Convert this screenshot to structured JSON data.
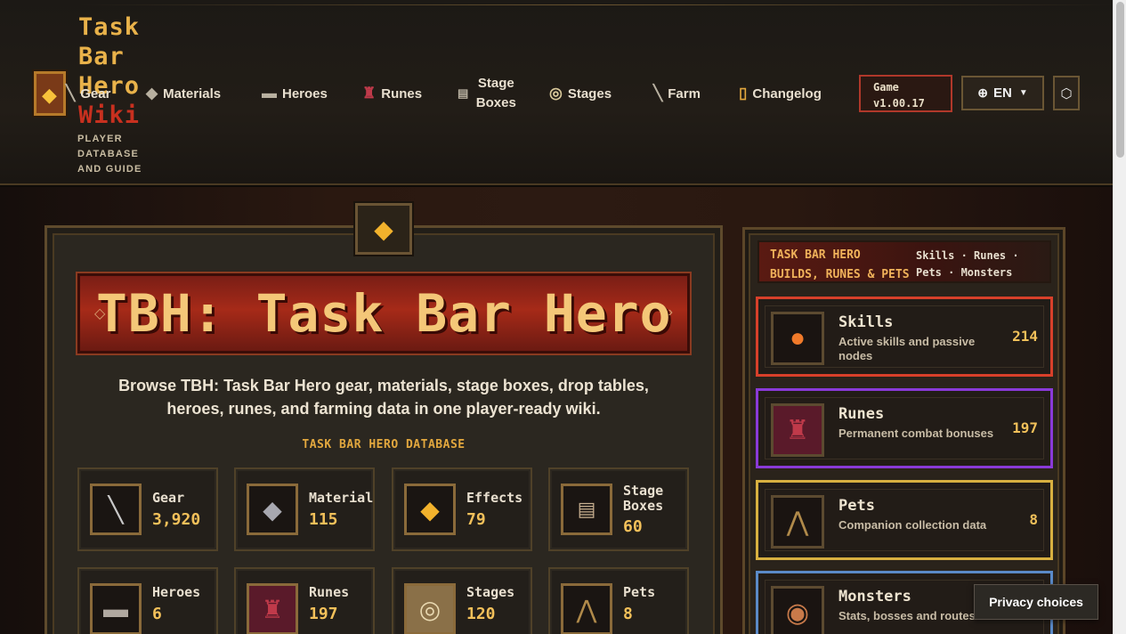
{
  "header": {
    "logo_line1": "Task",
    "logo_line2": "Bar",
    "logo_line3": "Hero",
    "logo_line4": "Wiki",
    "logo_sub": "PLAYER DATABASE AND GUIDE",
    "nav": [
      {
        "label": "Gear",
        "icon": "sword-icon"
      },
      {
        "label": "Materials",
        "icon": "ore-icon"
      },
      {
        "label": "Heroes",
        "icon": "hero-icon"
      },
      {
        "label": "Runes",
        "icon": "rune-icon"
      },
      {
        "label": "Stage Boxes",
        "icon": "chest-icon"
      },
      {
        "label": "Stages",
        "icon": "portal-icon"
      },
      {
        "label": "Farm",
        "icon": "sword-icon"
      },
      {
        "label": "Changelog",
        "icon": "scroll-icon"
      }
    ],
    "game_label": "Game",
    "game_version": "v1.00.17",
    "language": "EN"
  },
  "main": {
    "banner_title": "TBH: Task Bar Hero Wiki",
    "intro": "Browse TBH: Task Bar Hero gear, materials, stage boxes, drop tables, heroes, runes, and farming data in one player-ready wiki.",
    "db_label": "TASK BAR HERO DATABASE",
    "cards": [
      {
        "name": "Gear",
        "count": "3,920",
        "icon": "sword-icon"
      },
      {
        "name": "Material",
        "count": "115",
        "icon": "ore-icon"
      },
      {
        "name": "Effects",
        "count": "79",
        "icon": "gem-icon"
      },
      {
        "name": "Stage Boxes",
        "count": "60",
        "icon": "chest-icon"
      },
      {
        "name": "Heroes",
        "count": "6",
        "icon": "hero-icon"
      },
      {
        "name": "Runes",
        "count": "197",
        "icon": "rune-icon"
      },
      {
        "name": "Stages",
        "count": "120",
        "icon": "portal-icon"
      },
      {
        "name": "Pets",
        "count": "8",
        "icon": "bat-icon"
      }
    ]
  },
  "sidebar": {
    "title_line1": "TASK BAR HERO",
    "title_line2": "BUILDS, RUNES & PETS",
    "links_line1": "Skills · Runes ·",
    "links_line2": "Pets · Monsters",
    "categories": [
      {
        "name": "Skills",
        "desc": "Active skills and passive nodes",
        "count": "214",
        "color": "#d8402a",
        "icon": "fireball-icon"
      },
      {
        "name": "Runes",
        "desc": "Permanent combat bonuses",
        "count": "197",
        "color": "#8a3ad8",
        "icon": "rune-icon"
      },
      {
        "name": "Pets",
        "desc": "Companion collection data",
        "count": "8",
        "color": "#d8b040",
        "icon": "bat-icon"
      },
      {
        "name": "Monsters",
        "desc": "Stats, bosses and routes",
        "count": "",
        "color": "#5a8ac8",
        "icon": "golem-icon"
      }
    ]
  },
  "privacy_label": "Privacy choices"
}
